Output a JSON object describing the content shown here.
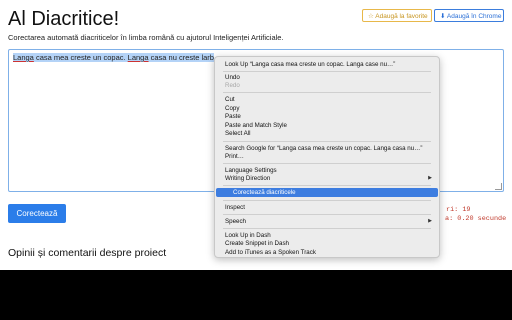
{
  "header": {
    "title": "Al Diacritice!",
    "subtitle": "Corectarea automată diacriticelor în limba română cu ajutorul Inteligenței Artificiale.",
    "favorite_button": "☆ Adaugă la favorite",
    "chrome_button": "⬇ Adaugă în Chrome"
  },
  "editor": {
    "text_part1": "Langa",
    "text_part2": " casa mea creste un copac. ",
    "text_part3": "Langa",
    "text_part4": " casa nu creste larb"
  },
  "actions": {
    "correct_button": "Corectează"
  },
  "stats": {
    "line1": "ri: 19",
    "line2": "a: 0.20 secunde"
  },
  "section": {
    "comments_title": "Opinii și comentarii despre proiect"
  },
  "context_menu": {
    "items": [
      {
        "label": "Look Up “Langa casa mea creste un copac. Langa case nu…”"
      },
      {
        "label": "Undo"
      },
      {
        "label": "Redo"
      },
      {
        "label": "Cut"
      },
      {
        "label": "Copy"
      },
      {
        "label": "Paste"
      },
      {
        "label": "Paste and Match Style"
      },
      {
        "label": "Select All"
      },
      {
        "label": "Search Google for “Langa casa mea creste un copac. Langa casa nu…”"
      },
      {
        "label": "Print…"
      },
      {
        "label": "Language Settings"
      },
      {
        "label": "Writing Direction"
      },
      {
        "label": "Corectează diacriticele"
      },
      {
        "label": "Inspect"
      },
      {
        "label": "Speech"
      },
      {
        "label": "Look Up in Dash"
      },
      {
        "label": "Create Snippet in Dash"
      },
      {
        "label": "Add to iTunes as a Spoken Track"
      }
    ]
  },
  "colors": {
    "accent": "#2b7de9",
    "menu_highlight": "#3d7de0",
    "stat_text": "#c0392b",
    "favorite_border": "#e8b84a"
  }
}
